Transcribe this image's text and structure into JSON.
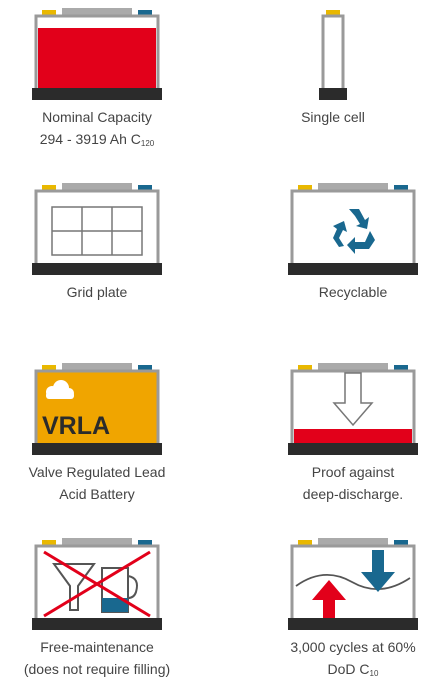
{
  "colors": {
    "frame": "#9a9a9a",
    "base": "#2b2b2b",
    "lid": "#aaaaaa",
    "terminal_pos": "#e9b800",
    "terminal_neg": "#19688f",
    "red": "#e2001a",
    "amber": "#f0a500",
    "text": "#444444"
  },
  "features": [
    {
      "icon": "battery-capacity-icon",
      "lines": [
        "Nominal Capacity",
        "294 - 3919 Ah C"
      ],
      "subscript": "120"
    },
    {
      "icon": "single-cell-icon",
      "lines": [
        "Single cell"
      ]
    },
    {
      "icon": "grid-plate-icon",
      "lines": [
        "Grid plate"
      ]
    },
    {
      "icon": "recycle-icon",
      "lines": [
        "Recyclable"
      ]
    },
    {
      "icon": "vrla-battery-icon",
      "badge": "VRLA",
      "lines": [
        "Valve Regulated Lead",
        "Acid Battery"
      ]
    },
    {
      "icon": "deep-discharge-icon",
      "lines": [
        "Proof against",
        "deep-discharge."
      ]
    },
    {
      "icon": "no-filling-icon",
      "lines": [
        "Free-maintenance",
        "(does not require filling)"
      ]
    },
    {
      "icon": "cycles-icon",
      "lines": [
        "3,000 cycles at 60%",
        "DoD C"
      ],
      "subscript": "10"
    }
  ]
}
